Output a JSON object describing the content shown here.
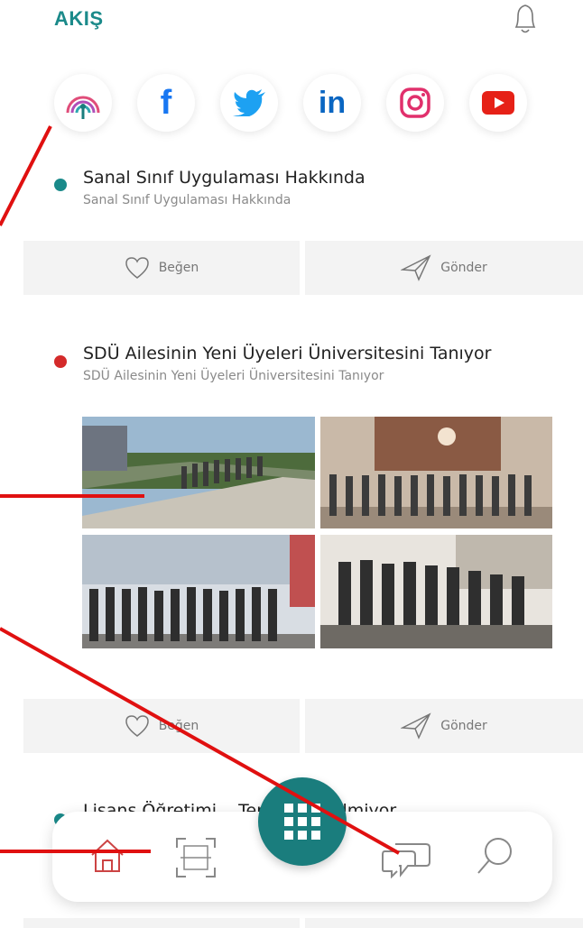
{
  "header": {
    "title": "AKIŞ",
    "bell_icon": "bell-icon"
  },
  "social": [
    {
      "name": "podcast-icon"
    },
    {
      "name": "facebook-icon",
      "glyph": "f",
      "color": "#1877f2"
    },
    {
      "name": "twitter-icon",
      "color": "#1da1f2"
    },
    {
      "name": "linkedin-icon",
      "glyph": "in",
      "color": "#0a66c2"
    },
    {
      "name": "instagram-icon",
      "color": "#e1306c"
    },
    {
      "name": "youtube-icon",
      "color": "#e62117"
    }
  ],
  "posts": [
    {
      "title": "Sanal Sınıf Uygulaması Hakkında",
      "subtitle": "Sanal Sınıf Uygulaması Hakkında",
      "dot_color": "#1a8a8a",
      "like": "Beğen",
      "send": "Gönder"
    },
    {
      "title": "SDÜ Ailesinin Yeni Üyeleri Üniversitesini Tanıyor",
      "subtitle": "SDÜ Ailesinin Yeni Üyeleri Üniversitesini Tanıyor",
      "dot_color": "#d42a2a",
      "like": "Beğen",
      "send": "Gönder"
    },
    {
      "title": "Lisans Öğretimi... Tercih Yükselmiyor",
      "dot_color": "#1a8a8a"
    }
  ],
  "nav": {
    "items": [
      "home-icon",
      "scan-icon",
      "apps-icon",
      "chat-icon",
      "search-icon"
    ]
  },
  "colors": {
    "accent": "#1a7d7d",
    "highlight": "#e01010"
  }
}
